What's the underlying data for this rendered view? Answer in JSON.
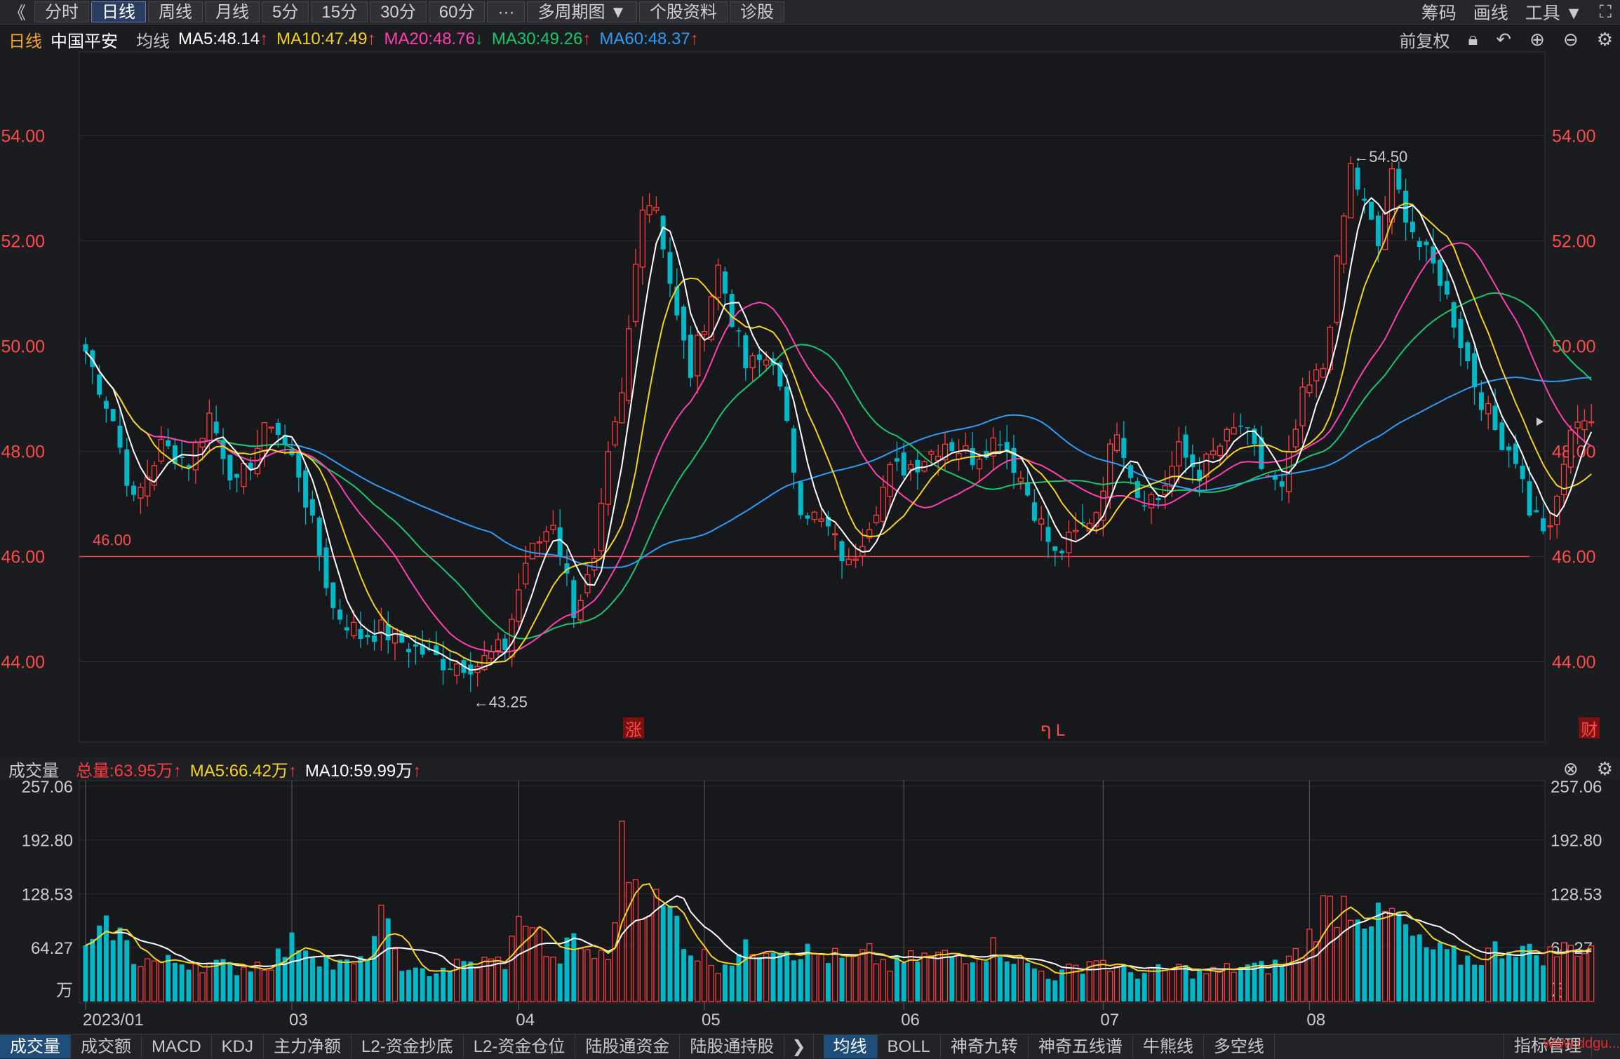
{
  "toolbar": {
    "back": "《",
    "periods": [
      "分时",
      "日线",
      "周线",
      "月线",
      "5分",
      "15分",
      "30分",
      "60分",
      "···",
      "多周期图 ▼",
      "个股资料",
      "诊股"
    ],
    "active_index": 1,
    "right": [
      "筹码",
      "画线",
      "工具 ▼"
    ],
    "fullscreen_icon": "⛶"
  },
  "info": {
    "period": "日线",
    "name": "中国平安",
    "ma_label": "均线",
    "ma5": "MA5:48.14",
    "ma10": "MA10:47.49",
    "ma20": "MA20:48.76",
    "ma30": "MA30:49.26",
    "ma60": "MA60:48.37",
    "up_arrow": "↑",
    "down_arrow": "↓",
    "adjust": "前复权",
    "icons": [
      "lock-icon",
      "undo-icon",
      "plus-icon",
      "minus-icon",
      "gear-icon"
    ]
  },
  "volume_info": {
    "label": "成交量",
    "total": "总量:63.95万",
    "ma5": "MA5:66.42万",
    "ma10": "MA10:59.99万",
    "up_arrow": "↑"
  },
  "bottom_tabs_left": [
    "成交量",
    "成交额",
    "MACD",
    "KDJ",
    "主力净额",
    "L2-资金抄底",
    "L2-资金仓位",
    "陆股通资金",
    "陆股通持股"
  ],
  "bottom_tabs_right": [
    "均线",
    "BOLL",
    "神奇九转",
    "神奇五线谱",
    "牛熊线",
    "多空线"
  ],
  "bottom_more": "❯",
  "bottom_right_btn": "指标管理",
  "watermark": "www.ddgu...",
  "colors": {
    "up": "#ff3b3b",
    "down": "#00b8c8",
    "ma5": "#ffffff",
    "ma10": "#f5d21e",
    "ma20": "#ff3fb0",
    "ma30": "#19c76a",
    "ma60": "#2e9cf5",
    "grid": "#2c2d33",
    "axis_text": "#ff4a4a"
  },
  "chart_data": {
    "type": "candlestick",
    "ylim": [
      42.5,
      55.3
    ],
    "yticks": [
      "54.00",
      "52.00",
      "50.00",
      "48.00",
      "46.00",
      "44.00"
    ],
    "ytick_values": [
      54,
      52,
      50,
      48,
      46,
      44
    ],
    "hline": {
      "value": 46.0,
      "label": "46.00"
    },
    "high_annotation": "←54.50",
    "low_annotation": "←43.25",
    "markers": [
      "涨",
      "ף L",
      "财"
    ],
    "month_labels": [
      "2023/01",
      "03",
      "04",
      "05",
      "06",
      "07",
      "08"
    ],
    "month_index": [
      0,
      30,
      63,
      90,
      119,
      148,
      178
    ],
    "vol_ylim": [
      0,
      257.06
    ],
    "vol_ticks": [
      "257.06",
      "192.80",
      "128.53",
      "64.27"
    ],
    "vol_tick_values": [
      257.06,
      192.8,
      128.53,
      64.27
    ],
    "vol_unit": "万",
    "anchors": {
      "close": [
        [
          0,
          49.9
        ],
        [
          4,
          48.6
        ],
        [
          7,
          47.0
        ],
        [
          11,
          48.1
        ],
        [
          15,
          47.8
        ],
        [
          18,
          48.7
        ],
        [
          22,
          47.3
        ],
        [
          27,
          48.6
        ],
        [
          31,
          47.6
        ],
        [
          36,
          45.0
        ],
        [
          40,
          44.5
        ],
        [
          43,
          44.6
        ],
        [
          47,
          44.3
        ],
        [
          52,
          44.0
        ],
        [
          57,
          43.95
        ],
        [
          61,
          44.3
        ],
        [
          64,
          45.9
        ],
        [
          68,
          46.7
        ],
        [
          71,
          45.0
        ],
        [
          74,
          45.8
        ],
        [
          76,
          47.8
        ],
        [
          78,
          49.0
        ],
        [
          81,
          52.8
        ],
        [
          83,
          52.7
        ],
        [
          86,
          50.5
        ],
        [
          88,
          49.5
        ],
        [
          92,
          51.5
        ],
        [
          96,
          49.6
        ],
        [
          100,
          49.8
        ],
        [
          104,
          47.0
        ],
        [
          108,
          46.5
        ],
        [
          111,
          45.8
        ],
        [
          114,
          46.7
        ],
        [
          117,
          47.6
        ],
        [
          121,
          47.8
        ],
        [
          125,
          48.2
        ],
        [
          129,
          47.9
        ],
        [
          133,
          48.3
        ],
        [
          136,
          47.5
        ],
        [
          139,
          46.6
        ],
        [
          141,
          46.0
        ],
        [
          144,
          46.4
        ],
        [
          147,
          46.9
        ],
        [
          150,
          48.5
        ],
        [
          153,
          47.2
        ],
        [
          156,
          47.1
        ],
        [
          159,
          48.0
        ],
        [
          162,
          47.6
        ],
        [
          165,
          48.1
        ],
        [
          168,
          48.5
        ],
        [
          171,
          47.7
        ],
        [
          174,
          47.2
        ],
        [
          177,
          49.0
        ],
        [
          180,
          49.6
        ],
        [
          184,
          53.4
        ],
        [
          188,
          51.9
        ],
        [
          190,
          53.2
        ],
        [
          194,
          51.9
        ],
        [
          197,
          51.3
        ],
        [
          200,
          50.1
        ],
        [
          202,
          49.3
        ],
        [
          205,
          48.4
        ],
        [
          208,
          47.9
        ],
        [
          210,
          46.9
        ],
        [
          213,
          46.4
        ],
        [
          215,
          47.8
        ],
        [
          217,
          48.7
        ],
        [
          219,
          48.6
        ]
      ],
      "vol": [
        [
          0,
          58
        ],
        [
          4,
          92
        ],
        [
          7,
          52
        ],
        [
          11,
          46
        ],
        [
          15,
          48
        ],
        [
          18,
          44
        ],
        [
          22,
          40
        ],
        [
          27,
          48
        ],
        [
          31,
          74
        ],
        [
          36,
          43
        ],
        [
          40,
          44
        ],
        [
          43,
          96
        ],
        [
          47,
          32
        ],
        [
          52,
          40
        ],
        [
          57,
          46
        ],
        [
          61,
          48
        ],
        [
          64,
          110
        ],
        [
          68,
          44
        ],
        [
          71,
          72
        ],
        [
          74,
          55
        ],
        [
          76,
          50
        ],
        [
          78,
          180
        ],
        [
          81,
          130
        ],
        [
          83,
          115
        ],
        [
          86,
          98
        ],
        [
          88,
          62
        ],
        [
          92,
          44
        ],
        [
          96,
          60
        ],
        [
          100,
          72
        ],
        [
          104,
          60
        ],
        [
          108,
          54
        ],
        [
          111,
          48
        ],
        [
          114,
          56
        ],
        [
          117,
          42
        ],
        [
          121,
          52
        ],
        [
          125,
          54
        ],
        [
          129,
          58
        ],
        [
          133,
          66
        ],
        [
          136,
          46
        ],
        [
          139,
          36
        ],
        [
          141,
          30
        ],
        [
          144,
          40
        ],
        [
          147,
          52
        ],
        [
          150,
          38
        ],
        [
          153,
          34
        ],
        [
          156,
          36
        ],
        [
          159,
          40
        ],
        [
          162,
          34
        ],
        [
          165,
          36
        ],
        [
          168,
          42
        ],
        [
          171,
          40
        ],
        [
          174,
          45
        ],
        [
          177,
          62
        ],
        [
          180,
          110
        ],
        [
          184,
          120
        ],
        [
          188,
          95
        ],
        [
          190,
          105
        ],
        [
          194,
          66
        ],
        [
          197,
          58
        ],
        [
          200,
          52
        ],
        [
          202,
          50
        ],
        [
          205,
          62
        ],
        [
          208,
          68
        ],
        [
          210,
          58
        ],
        [
          213,
          56
        ],
        [
          215,
          62
        ],
        [
          217,
          66
        ],
        [
          219,
          64
        ]
      ]
    }
  }
}
